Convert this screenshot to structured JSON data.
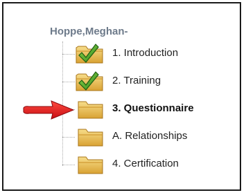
{
  "tree": {
    "owner": "Hoppe,Meghan-",
    "items": [
      {
        "label": "1. Introduction",
        "icon": "folder-check-icon",
        "status": "completed",
        "active": false
      },
      {
        "label": "2. Training",
        "icon": "folder-check-icon",
        "status": "completed",
        "active": false
      },
      {
        "label": "3. Questionnaire",
        "icon": "folder-icon",
        "status": "current",
        "active": true
      },
      {
        "label": "A. Relationships",
        "icon": "folder-icon",
        "status": "pending",
        "active": false
      },
      {
        "label": "4. Certification",
        "icon": "folder-icon",
        "status": "pending",
        "active": false
      }
    ]
  },
  "colors": {
    "folder": "#e9b84a",
    "check": "#4aa52e",
    "pointer": "#e0141c",
    "owner_text": "#6d7a8a"
  }
}
